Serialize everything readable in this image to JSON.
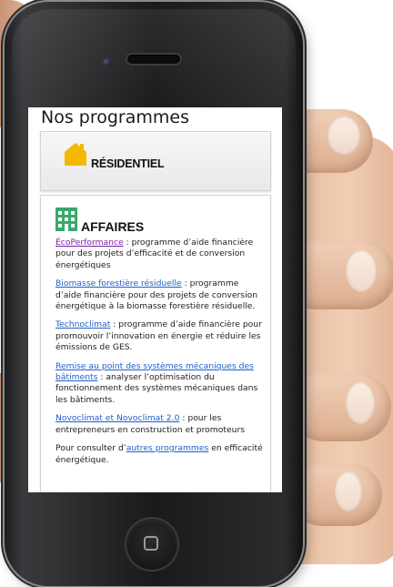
{
  "screen": {
    "page_title": "Nos programmes",
    "residential": {
      "label": "RÉSIDENTIEL",
      "icon": "house-icon",
      "icon_color": "#f5b800"
    },
    "business": {
      "label": "AFFAIRES",
      "icon": "building-icon",
      "icon_color": "#3aa86b",
      "programs": [
        {
          "link": "ÉcoPerformance",
          "text": " : programme d’aide financière pour des projets d’efficacité et de conversion énergétiques"
        },
        {
          "link": "Biomasse forestière résiduelle",
          "text": " : programme d’aide financière pour des projets de conversion énergétique à la biomasse forestière résiduelle."
        },
        {
          "link": "Technoclimat",
          "text": " : programme d’aide financière pour promouvoir l’innovation en énergie et réduire les émissions de GES."
        },
        {
          "link": "Remise au point des systèmes mécaniques des bâtiments",
          "text": " : analyser l’optimisation du fonctionnement des systèmes mécaniques dans les bâtiments."
        },
        {
          "link": "Novoclimat et Novoclimat 2.0",
          "text": " : pour les entrepreneurs en construction et promoteurs"
        }
      ],
      "footer": {
        "prefix": "Pour consulter d’",
        "link": "autres programmes",
        "suffix": " en efficacité énergétique."
      }
    },
    "link_color": "#1f5fc9",
    "visited_link_color": "#7b1fa2"
  }
}
